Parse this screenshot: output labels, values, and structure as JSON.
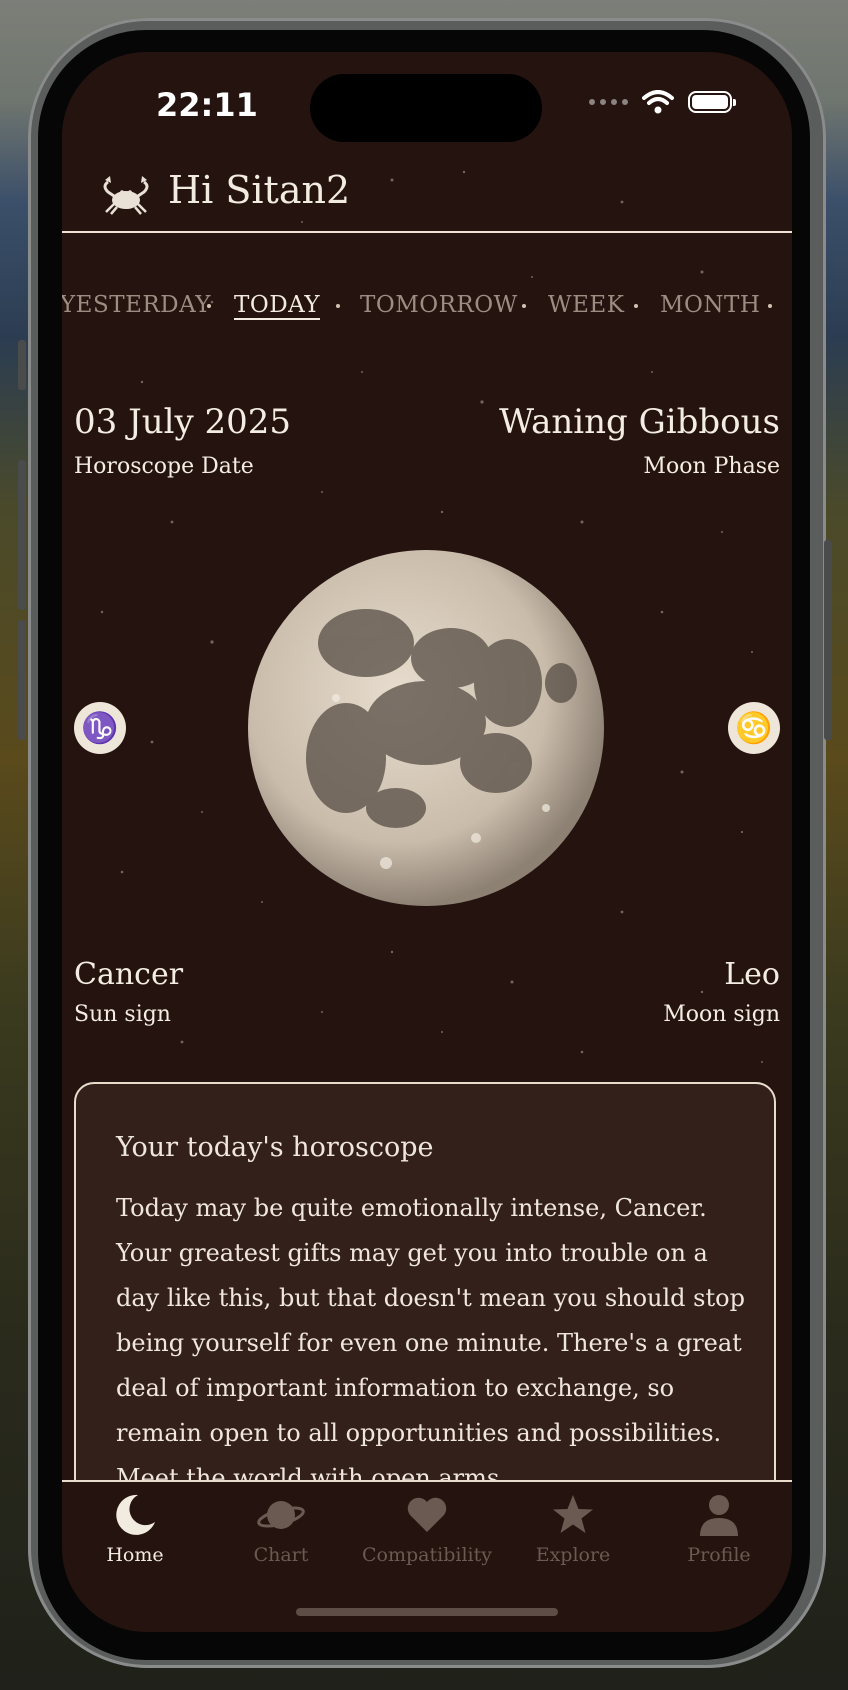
{
  "status_bar": {
    "time": "22:11"
  },
  "header": {
    "greeting": "Hi Sitan2",
    "icon": "crab-icon"
  },
  "period_tabs": [
    {
      "label": "YESTERDAY",
      "active": false
    },
    {
      "label": "TODAY",
      "active": true
    },
    {
      "label": "TOMORROW",
      "active": false
    },
    {
      "label": "WEEK",
      "active": false
    },
    {
      "label": "MONTH",
      "active": false
    }
  ],
  "date_info": {
    "value": "03 July 2025",
    "label": "Horoscope Date"
  },
  "moon_phase": {
    "value": "Waning Gibbous",
    "label": "Moon Phase"
  },
  "sun_sign": {
    "value": "Cancer",
    "label": "Sun sign"
  },
  "moon_sign": {
    "value": "Leo",
    "label": "Moon sign"
  },
  "zodiac_buttons": {
    "left": {
      "glyph": "♑",
      "icon": "capricorn-icon"
    },
    "right": {
      "glyph": "♋",
      "icon": "cancer-icon"
    }
  },
  "horoscope_card": {
    "title": "Your today's horoscope",
    "body": "Today may be quite emotionally intense, Cancer. Your greatest gifts may get you into trouble on a day like this, but that doesn't mean you should stop being yourself for even one minute. There's a great deal of important information to exchange, so remain open to all opportunities and possibilities. Meet the world with open arms."
  },
  "bottom_nav": [
    {
      "label": "Home",
      "icon": "moon-icon",
      "active": true
    },
    {
      "label": "Chart",
      "icon": "planet-icon",
      "active": false
    },
    {
      "label": "Compatibility",
      "icon": "heart-icon",
      "active": false
    },
    {
      "label": "Explore",
      "icon": "star-icon",
      "active": false
    },
    {
      "label": "Profile",
      "icon": "person-icon",
      "active": false
    }
  ],
  "colors": {
    "background": "#24130f",
    "card": "#33201b",
    "text": "#f2ebe0",
    "inactive": "#6b5a52",
    "accent_line": "#e8dccd"
  }
}
